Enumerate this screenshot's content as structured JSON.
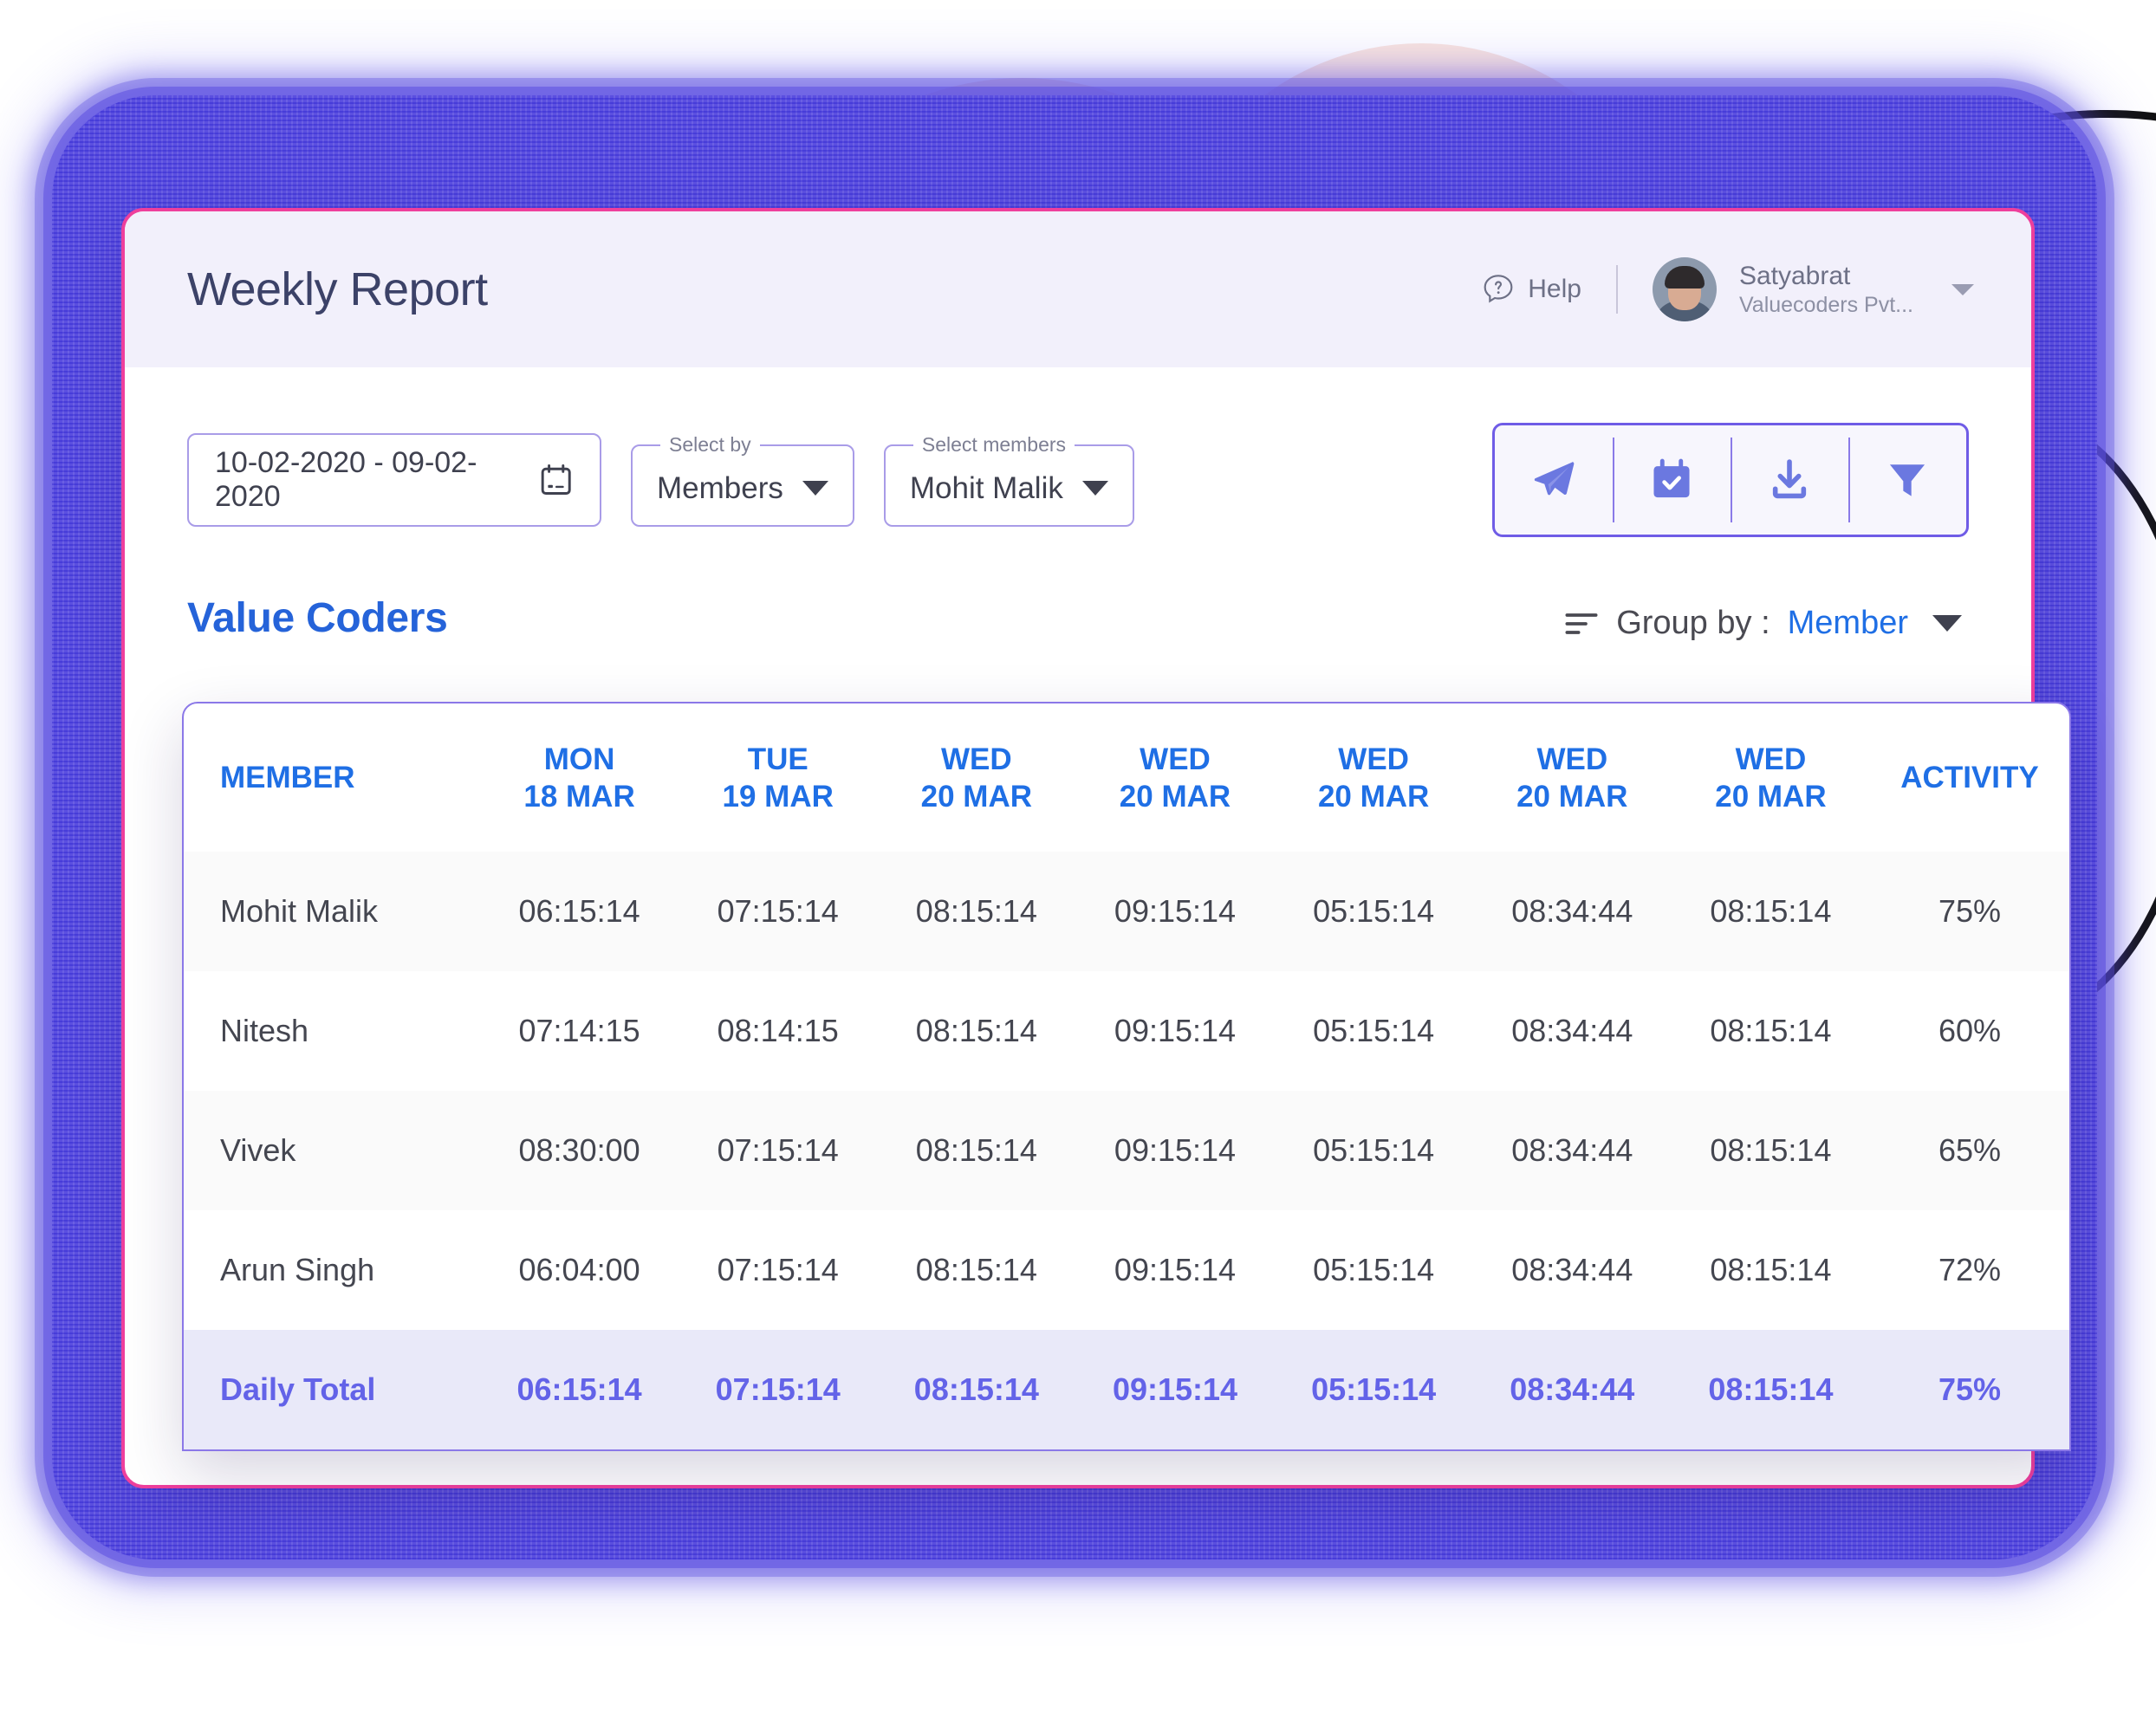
{
  "colors": {
    "frame_purple": "#5b4fe0",
    "card_border_pink": "#ee3f9c",
    "header_bg": "#f2f0fb",
    "accent_blue": "#1f6fe5",
    "section_blue": "#2563d9",
    "periwinkle": "#6363e8",
    "field_border": "#a99ce8",
    "cloud_peach": "#f9e4dd",
    "total_row_bg": "#e9e9f9"
  },
  "header": {
    "title": "Weekly Report",
    "help_label": "Help",
    "help_icon": "question-bubble-icon",
    "user": {
      "name": "Satyabrat",
      "org": "Valuecoders Pvt...",
      "avatar_icon": "user-avatar",
      "chevron_icon": "chevron-down-icon"
    }
  },
  "filters": {
    "date_range": {
      "value": "10-02-2020 - 09-02-2020",
      "icon": "calendar-icon"
    },
    "select_by": {
      "legend": "Select by",
      "value": "Members",
      "caret_icon": "caret-down-icon"
    },
    "select_members": {
      "legend": "Select members",
      "value": "Mohit Malik",
      "caret_icon": "caret-down-icon"
    },
    "toolbar": [
      {
        "name": "send-button",
        "icon": "paper-plane-icon"
      },
      {
        "name": "schedule-button",
        "icon": "calendar-check-icon"
      },
      {
        "name": "download-button",
        "icon": "download-icon"
      },
      {
        "name": "filter-button",
        "icon": "funnel-icon"
      }
    ]
  },
  "section": {
    "title": "Value Coders",
    "group_by_label": "Group by :",
    "group_by_value": "Member",
    "sort_icon": "sort-lines-icon",
    "caret_icon": "caret-down-icon"
  },
  "chart_data": {
    "type": "table",
    "title": "Value Coders",
    "columns": [
      {
        "label_top": "MEMBER",
        "label_bottom": ""
      },
      {
        "label_top": "MON",
        "label_bottom": "18 MAR"
      },
      {
        "label_top": "TUE",
        "label_bottom": "19 MAR"
      },
      {
        "label_top": "WED",
        "label_bottom": "20 MAR"
      },
      {
        "label_top": "WED",
        "label_bottom": "20 MAR"
      },
      {
        "label_top": "WED",
        "label_bottom": "20 MAR"
      },
      {
        "label_top": "WED",
        "label_bottom": "20 MAR"
      },
      {
        "label_top": "WED",
        "label_bottom": "20 MAR"
      },
      {
        "label_top": "ACTIVITY",
        "label_bottom": ""
      }
    ],
    "rows": [
      {
        "member": "Mohit Malik",
        "values": [
          "06:15:14",
          "07:15:14",
          "08:15:14",
          "09:15:14",
          "05:15:14",
          "08:34:44",
          "08:15:14"
        ],
        "activity": "75%"
      },
      {
        "member": "Nitesh",
        "values": [
          "07:14:15",
          "08:14:15",
          "08:15:14",
          "09:15:14",
          "05:15:14",
          "08:34:44",
          "08:15:14"
        ],
        "activity": "60%"
      },
      {
        "member": "Vivek",
        "values": [
          "08:30:00",
          "07:15:14",
          "08:15:14",
          "09:15:14",
          "05:15:14",
          "08:34:44",
          "08:15:14"
        ],
        "activity": "65%"
      },
      {
        "member": "Arun Singh",
        "values": [
          "06:04:00",
          "07:15:14",
          "08:15:14",
          "09:15:14",
          "05:15:14",
          "08:34:44",
          "08:15:14"
        ],
        "activity": "72%"
      }
    ],
    "total_row": {
      "member": "Daily Total",
      "values": [
        "06:15:14",
        "07:15:14",
        "08:15:14",
        "09:15:14",
        "05:15:14",
        "08:34:44",
        "08:15:14"
      ],
      "activity": "75%"
    }
  }
}
